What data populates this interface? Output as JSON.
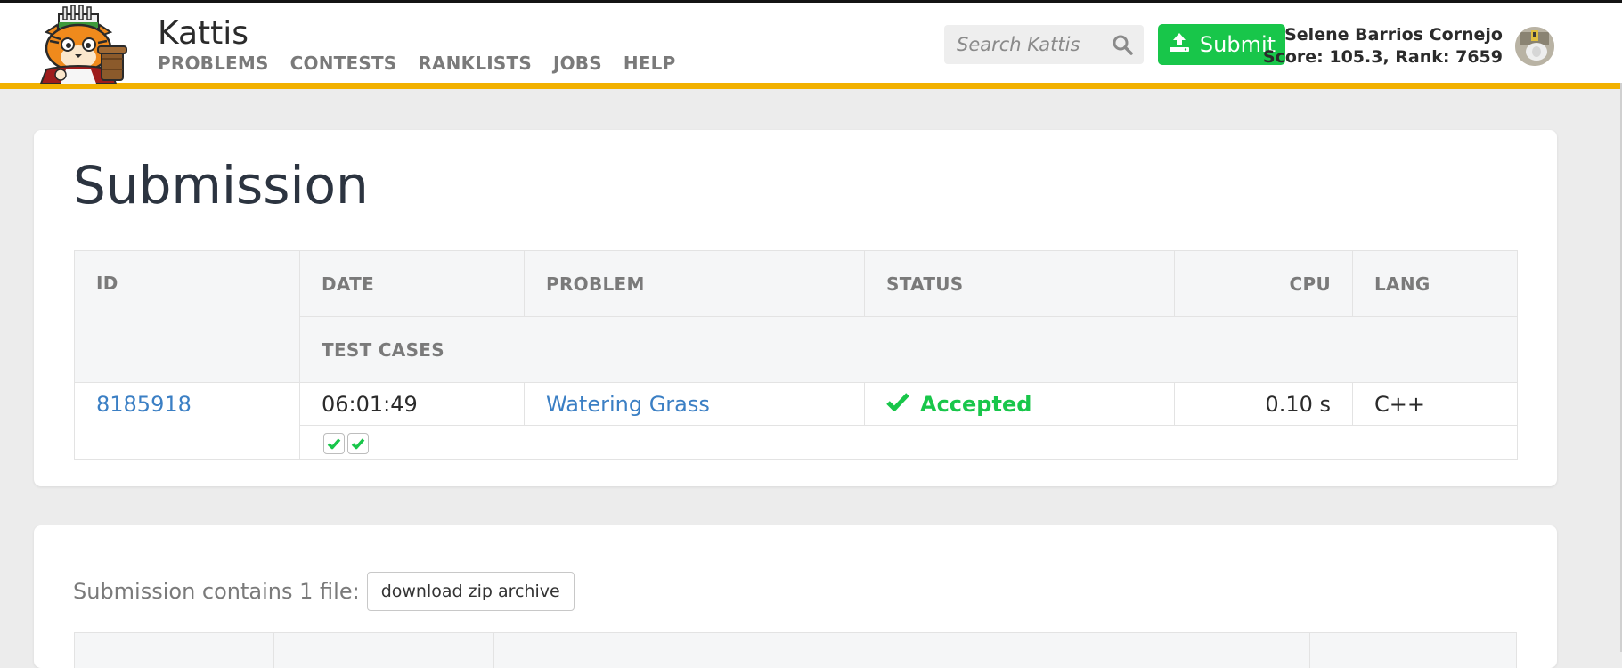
{
  "header": {
    "brand": "Kattis",
    "nav": [
      "PROBLEMS",
      "CONTESTS",
      "RANKLISTS",
      "JOBS",
      "HELP"
    ],
    "search_placeholder": "Search Kattis",
    "submit_label": "Submit",
    "user_name": "Selene Barrios Cornejo",
    "user_score": "Score: 105.3, Rank: 7659"
  },
  "page": {
    "title": "Submission"
  },
  "submission_table": {
    "headers": {
      "id": "ID",
      "date": "DATE",
      "problem": "PROBLEM",
      "status": "STATUS",
      "cpu": "CPU",
      "lang": "LANG",
      "test_cases": "TEST CASES"
    },
    "row": {
      "id": "8185918",
      "date": "06:01:49",
      "problem": "Watering Grass",
      "status": "Accepted",
      "cpu": "0.10 s",
      "lang": "C++",
      "test_cases_passed": 2
    }
  },
  "files": {
    "text": "Submission contains 1 file:",
    "download_label": "download zip archive"
  },
  "colors": {
    "accent": "#f2b100",
    "success": "#18c64a",
    "link": "#3b7fc4"
  },
  "icons": {
    "logo": "kattis-cat-logo",
    "search": "search-icon",
    "submit": "upload-icon",
    "status": "checkmark-icon",
    "avatar": "avatar"
  }
}
